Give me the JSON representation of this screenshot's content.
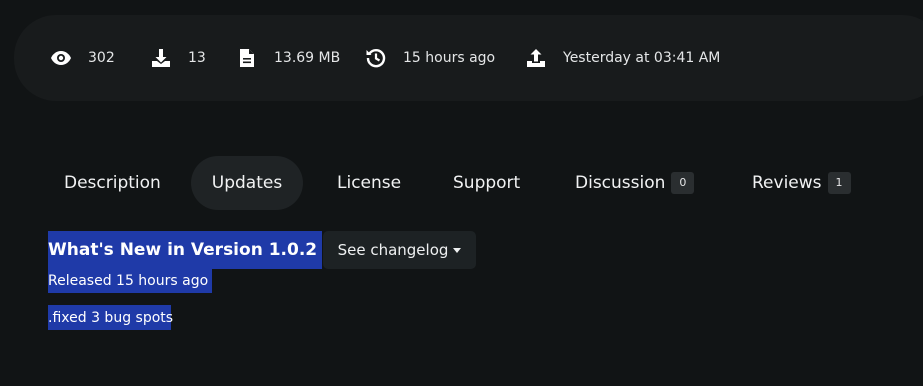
{
  "stats": {
    "views": {
      "icon": "eye-icon",
      "value": "302"
    },
    "downloads": {
      "icon": "download-icon",
      "value": "13"
    },
    "size": {
      "icon": "file-icon",
      "value": "13.69 MB"
    },
    "updated": {
      "icon": "history-icon",
      "value": "15 hours ago"
    },
    "uploaded": {
      "icon": "upload-icon",
      "value": "Yesterday at 03:41 AM"
    }
  },
  "tabs": [
    {
      "label": "Description"
    },
    {
      "label": "Updates",
      "active": true
    },
    {
      "label": "License"
    },
    {
      "label": "Support"
    },
    {
      "label": "Discussion",
      "badge": "0"
    },
    {
      "label": "Reviews",
      "badge": "1"
    }
  ],
  "update": {
    "title": "What's New in Version 1.0.2",
    "changelog_label": "See changelog",
    "released": "Released 15 hours ago",
    "note": ".fixed 3 bug spots"
  },
  "colors": {
    "background": "#111415",
    "panel": "#181b1c",
    "active_tab": "#1f2325",
    "selection": "#1f3aa8"
  }
}
